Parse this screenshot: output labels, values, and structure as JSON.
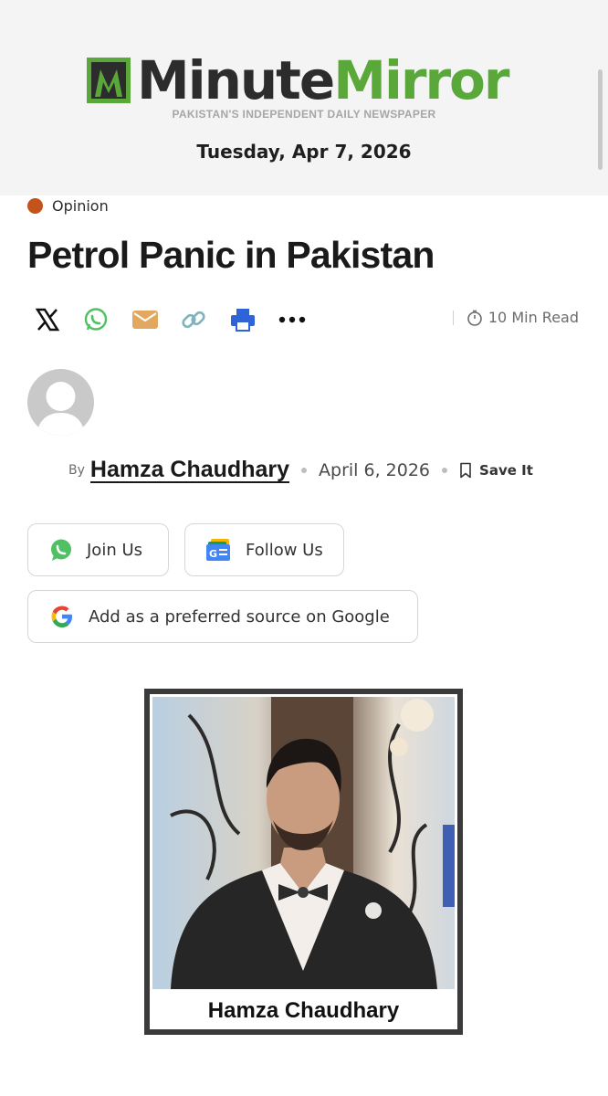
{
  "header": {
    "logo": {
      "minute": "Minute",
      "mirror": "Mirror"
    },
    "tagline": "PAKISTAN'S INDEPENDENT DAILY NEWSPAPER",
    "date": "Tuesday, Apr 7, 2026"
  },
  "article": {
    "category": "Opinion",
    "title": "Petrol Panic in Pakistan",
    "read_time": "10 Min Read",
    "by_label": "By",
    "author": "Hamza Chaudhary",
    "date": "April 6, 2026",
    "save_label": "Save It"
  },
  "share_icons": [
    "x-icon",
    "whatsapp-icon",
    "email-icon",
    "link-icon",
    "print-icon",
    "more-icon"
  ],
  "follow": {
    "join_label": "Join Us",
    "follow_label": "Follow Us",
    "google_label": "Add as a preferred source on Google"
  },
  "photo": {
    "caption": "Hamza Chaudhary"
  },
  "colors": {
    "brand_green": "#5aa83a",
    "brand_dark": "#2c2c2c",
    "category_dot": "#c4521b",
    "whatsapp": "#4fc163",
    "email": "#e3a85f",
    "link": "#7fb3bd",
    "print": "#2f64d8"
  }
}
